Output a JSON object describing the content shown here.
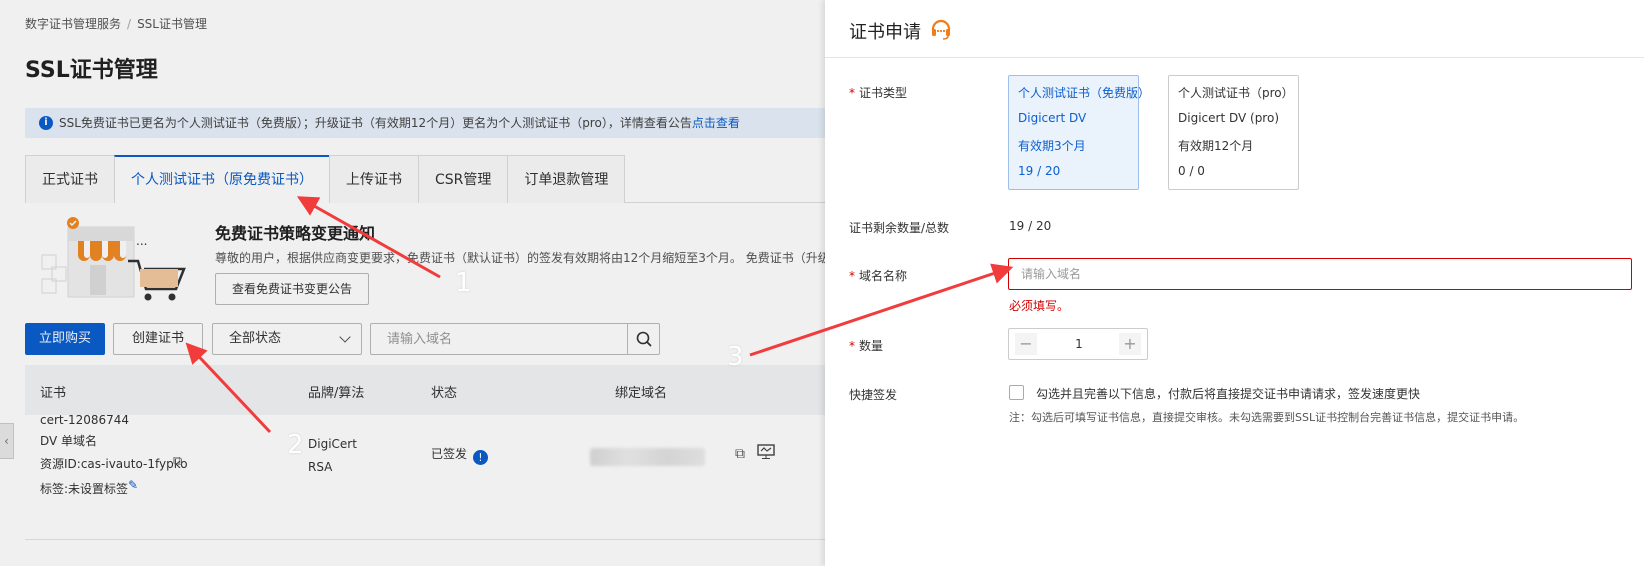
{
  "breadcrumb": {
    "root": "数字证书管理服务",
    "separator": "/",
    "current": "SSL证书管理"
  },
  "page_title": "SSL证书管理",
  "notice": {
    "text": "SSL免费证书已更名为个人测试证书（免费版）；升级证书（有效期12个月）更名为个人测试证书（pro），详情查看公告",
    "link": "点击查看"
  },
  "tabs": [
    {
      "label": "正式证书"
    },
    {
      "label": "个人测试证书（原免费证书）"
    },
    {
      "label": "上传证书"
    },
    {
      "label": "CSR管理"
    },
    {
      "label": "订单退款管理"
    }
  ],
  "promo": {
    "title": "免费证书策略变更通知",
    "desc": "尊敬的用户，根据供应商变更要求，免费证书（默认证书）的签发有效期将由12个月缩短至3个月。 免费证书（升级",
    "button": "查看免费证书变更公告"
  },
  "toolbar": {
    "buy_label": "立即购买",
    "create_label": "创建证书",
    "status_select": "全部状态",
    "search_placeholder": "请输入域名"
  },
  "table": {
    "headers": [
      "证书",
      "品牌/算法",
      "状态",
      "绑定域名"
    ],
    "rows": [
      {
        "cert_id": "cert-12086744",
        "cert_type": "DV 单域名",
        "resource_id": "资源ID:cas-ivauto-1fypko",
        "tags": "标签:未设置标签",
        "brand": "DigiCert",
        "algo": "RSA",
        "status": "已签发"
      }
    ]
  },
  "drawer": {
    "title": "证书申请",
    "cert_type_label": "证书类型",
    "cards": [
      {
        "name": "个人测试证书（免费版）",
        "brand": "Digicert DV",
        "validity": "有效期3个月",
        "count": "19 / 20"
      },
      {
        "name": "个人测试证书（pro）",
        "brand": "Digicert DV (pro)",
        "validity": "有效期12个月",
        "count": "0 / 0"
      }
    ],
    "remaining_label": "证书剩余数量/总数",
    "remaining_value": "19 / 20",
    "domain_label": "域名名称",
    "domain_placeholder": "请输入域名",
    "domain_error": "必须填写。",
    "quantity_label": "数量",
    "quantity_value": "1",
    "minus": "−",
    "plus": "+",
    "fast_label": "快捷签发",
    "fast_text": "勾选并且完善以下信息，付款后将直接提交证书申请请求，签发速度更快",
    "fast_note": "注：勾选后可填写证书信息，直接提交审核。未勾选需要到SSL证书控制台完善证书信息，提交证书申请。"
  },
  "annotations": {
    "n1": "1",
    "n2": "2",
    "n3": "3"
  },
  "colors": {
    "primary": "#0b5fcf",
    "error": "#d40000",
    "arrow": "#f23b3b",
    "headset": "#f07c1a"
  }
}
